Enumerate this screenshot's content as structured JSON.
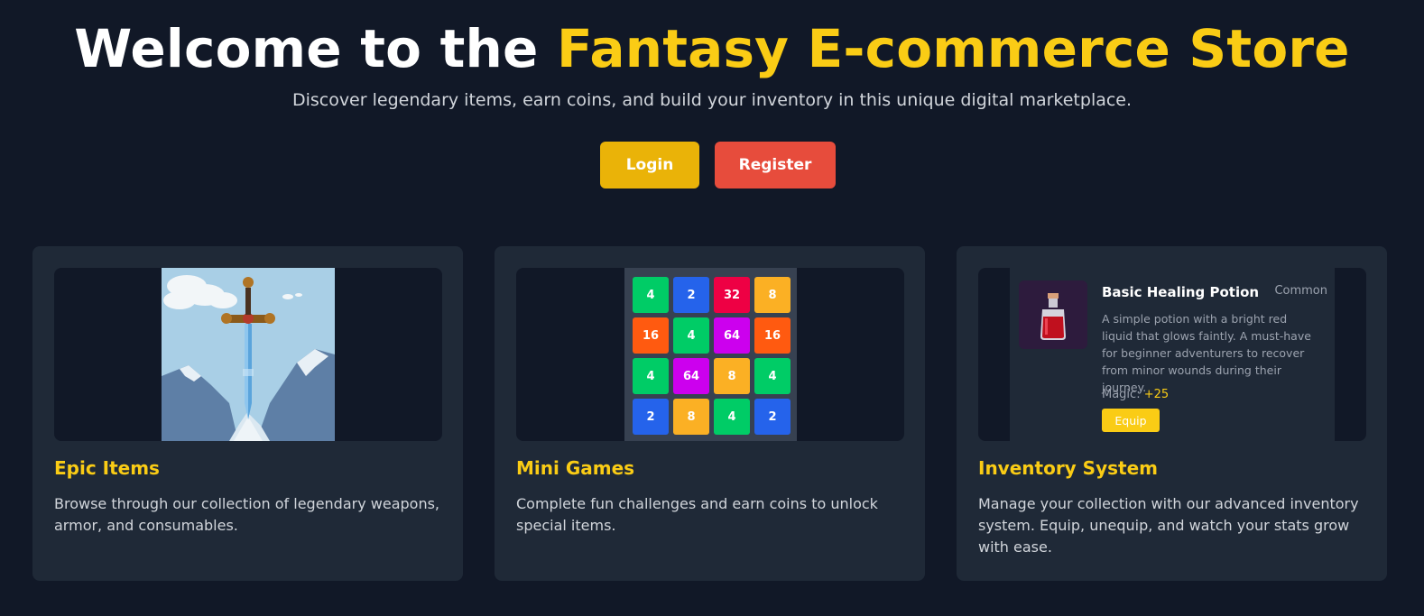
{
  "hero": {
    "title_prefix": "Welcome to the",
    "title_accent": "Fantasy E-commerce Store",
    "subtitle": "Discover legendary items, earn coins, and build your inventory in this unique digital marketplace."
  },
  "buttons": {
    "login": "Login",
    "register": "Register"
  },
  "features": [
    {
      "title": "Epic Items",
      "description": "Browse through our collection of legendary weapons, armor, and consumables."
    },
    {
      "title": "Mini Games",
      "description": "Complete fun challenges and earn coins to unlock special items."
    },
    {
      "title": "Inventory System",
      "description": "Manage your collection with our advanced inventory system. Equip, unequip, and watch your stats grow with ease."
    }
  ],
  "game_grid": [
    {
      "v": "4",
      "c": "#00cc66"
    },
    {
      "v": "2",
      "c": "#2563eb"
    },
    {
      "v": "32",
      "c": "#ee0044"
    },
    {
      "v": "8",
      "c": "#fbb024"
    },
    {
      "v": "16",
      "c": "#ff5a10"
    },
    {
      "v": "4",
      "c": "#00cc66"
    },
    {
      "v": "64",
      "c": "#cc00ee"
    },
    {
      "v": "16",
      "c": "#ff5a10"
    },
    {
      "v": "4",
      "c": "#00cc66"
    },
    {
      "v": "64",
      "c": "#cc00ee"
    },
    {
      "v": "8",
      "c": "#fbb024"
    },
    {
      "v": "4",
      "c": "#00cc66"
    },
    {
      "v": "2",
      "c": "#2563eb"
    },
    {
      "v": "8",
      "c": "#fbb024"
    },
    {
      "v": "4",
      "c": "#00cc66"
    },
    {
      "v": "2",
      "c": "#2563eb"
    }
  ],
  "inventory_item": {
    "name": "Basic Healing Potion",
    "rarity": "Common",
    "description": "A simple potion with a bright red liquid that glows faintly. A must-have for beginner adventurers to recover from minor wounds during their journey.",
    "stat_label": "Magic:",
    "stat_value": "+25",
    "equip_label": "Equip"
  },
  "colors": {
    "background": "#111827",
    "card": "#1f2937",
    "accent": "#facc15",
    "login": "#eab308",
    "register": "#e74c3c"
  }
}
